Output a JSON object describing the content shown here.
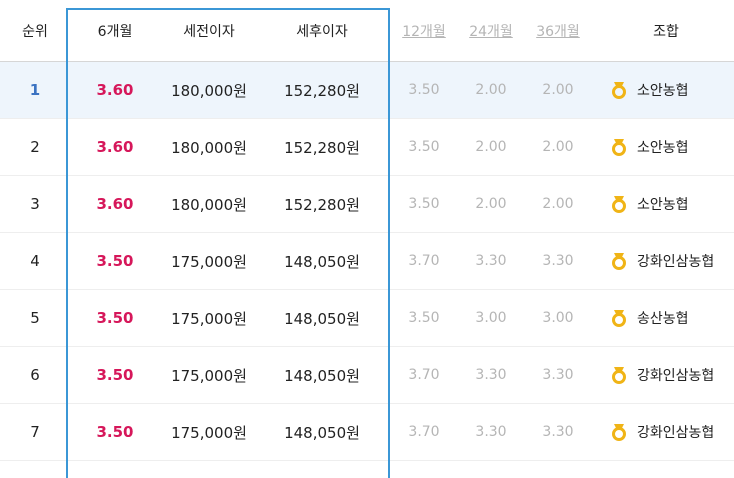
{
  "header": {
    "rank": "순위",
    "m6": "6개월",
    "pre_tax": "세전이자",
    "post_tax": "세후이자",
    "m12": "12개월",
    "m24": "24개월",
    "m36": "36개월",
    "union": "조합"
  },
  "rows": [
    {
      "rank": "1",
      "m6": "3.60",
      "pre_tax": "180,000원",
      "post_tax": "152,280원",
      "m12": "3.50",
      "m24": "2.00",
      "m36": "2.00",
      "union": "소안농협",
      "icon": "medal-icon"
    },
    {
      "rank": "2",
      "m6": "3.60",
      "pre_tax": "180,000원",
      "post_tax": "152,280원",
      "m12": "3.50",
      "m24": "2.00",
      "m36": "2.00",
      "union": "소안농협",
      "icon": "medal-icon"
    },
    {
      "rank": "3",
      "m6": "3.60",
      "pre_tax": "180,000원",
      "post_tax": "152,280원",
      "m12": "3.50",
      "m24": "2.00",
      "m36": "2.00",
      "union": "소안농협",
      "icon": "medal-icon"
    },
    {
      "rank": "4",
      "m6": "3.50",
      "pre_tax": "175,000원",
      "post_tax": "148,050원",
      "m12": "3.70",
      "m24": "3.30",
      "m36": "3.30",
      "union": "강화인삼농협",
      "icon": "medal-icon"
    },
    {
      "rank": "5",
      "m6": "3.50",
      "pre_tax": "175,000원",
      "post_tax": "148,050원",
      "m12": "3.50",
      "m24": "3.00",
      "m36": "3.00",
      "union": "송산농협",
      "icon": "medal-icon"
    },
    {
      "rank": "6",
      "m6": "3.50",
      "pre_tax": "175,000원",
      "post_tax": "148,050원",
      "m12": "3.70",
      "m24": "3.30",
      "m36": "3.30",
      "union": "강화인삼농협",
      "icon": "medal-icon"
    },
    {
      "rank": "7",
      "m6": "3.50",
      "pre_tax": "175,000원",
      "post_tax": "148,050원",
      "m12": "3.70",
      "m24": "3.30",
      "m36": "3.30",
      "union": "강화인삼농협",
      "icon": "medal-icon"
    }
  ],
  "colors": {
    "rate": "#d6175a",
    "highlight_border": "#3b97d6",
    "first_row_bg": "#eef5fc",
    "medal": "#f0b416"
  }
}
